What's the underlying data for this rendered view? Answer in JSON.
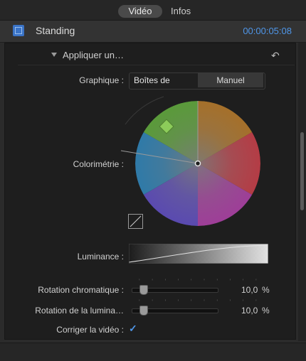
{
  "tabs": {
    "video": "Vidéo",
    "infos": "Infos"
  },
  "header": {
    "clip_name": "Standing",
    "timecode": "00:00:05:08"
  },
  "section": {
    "title": "Appliquer un…"
  },
  "graphique": {
    "label": "Graphique :",
    "options": [
      "Boîtes de",
      "Manuel"
    ]
  },
  "colorimetrie": {
    "label": "Colorimétrie :"
  },
  "luminance": {
    "label": "Luminance :"
  },
  "rotation_chromatique": {
    "label": "Rotation chromatique :",
    "value": "10,0",
    "unit": "%"
  },
  "rotation_luminance": {
    "label": "Rotation de la lumina…",
    "value": "10,0",
    "unit": "%"
  },
  "corriger": {
    "label": "Corriger la vidéo :",
    "checked": true
  },
  "icons": {
    "clip": "film-clip-icon",
    "reset": "reset-arrow-icon",
    "disclosure": "disclosure-triangle-icon",
    "curve": "curve-icon",
    "checkbox": "checkmark-icon"
  },
  "colors": {
    "accent": "#4f96e8",
    "background": "#1e1e1e"
  }
}
